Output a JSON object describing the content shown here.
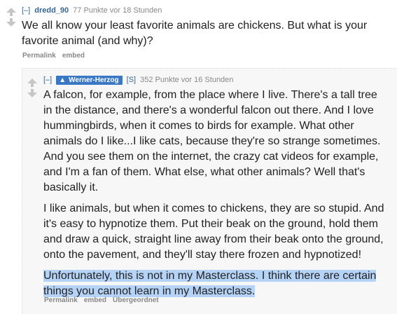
{
  "parent": {
    "toggle": "[–]",
    "author": "dredd_90",
    "score_time": "77 Punkte vor 18 Stunden",
    "body": "We all know your least favorite animals are chickens. But what is your favorite animal (and why)?",
    "buttons": [
      "Permalink",
      "embed"
    ]
  },
  "reply": {
    "toggle": "[–]",
    "author_badge": "Werner-Herzog",
    "flair": "[S]",
    "score_time": "352 Punkte vor 16 Stunden",
    "paragraph1": "A falcon, for example, from the place where I live. There's a tall tree in the distance, and there's a wonderful falcon out there. And I love hummingbirds, when it comes to birds for example. What other animals do I like...I like cats, because they're so strange sometimes. And you see them on the internet, the crazy cat videos for example, and I'm a fan of them. What else, what other animals? Well that's basically it.",
    "paragraph2": "I like animals, but when it comes to chickens, they are so stupid. And it's easy to hypnotize them. Put their beak on the ground, hold them and draw a quick, straight line away from their beak onto the ground, onto the pavement, and they'll stay there frozen and hypnotized!",
    "paragraph3": "Unfortunately, this is not in my Masterclass. I think there are certain things you cannot learn in my Masterclass.",
    "buttons": [
      "Permalink",
      "embed",
      "Übergeordnet"
    ]
  },
  "colors": {
    "link": "#336699",
    "badge": "#3a78c5",
    "highlight": "#b5d3f7",
    "vote_arrow": "#c6c6c6"
  }
}
